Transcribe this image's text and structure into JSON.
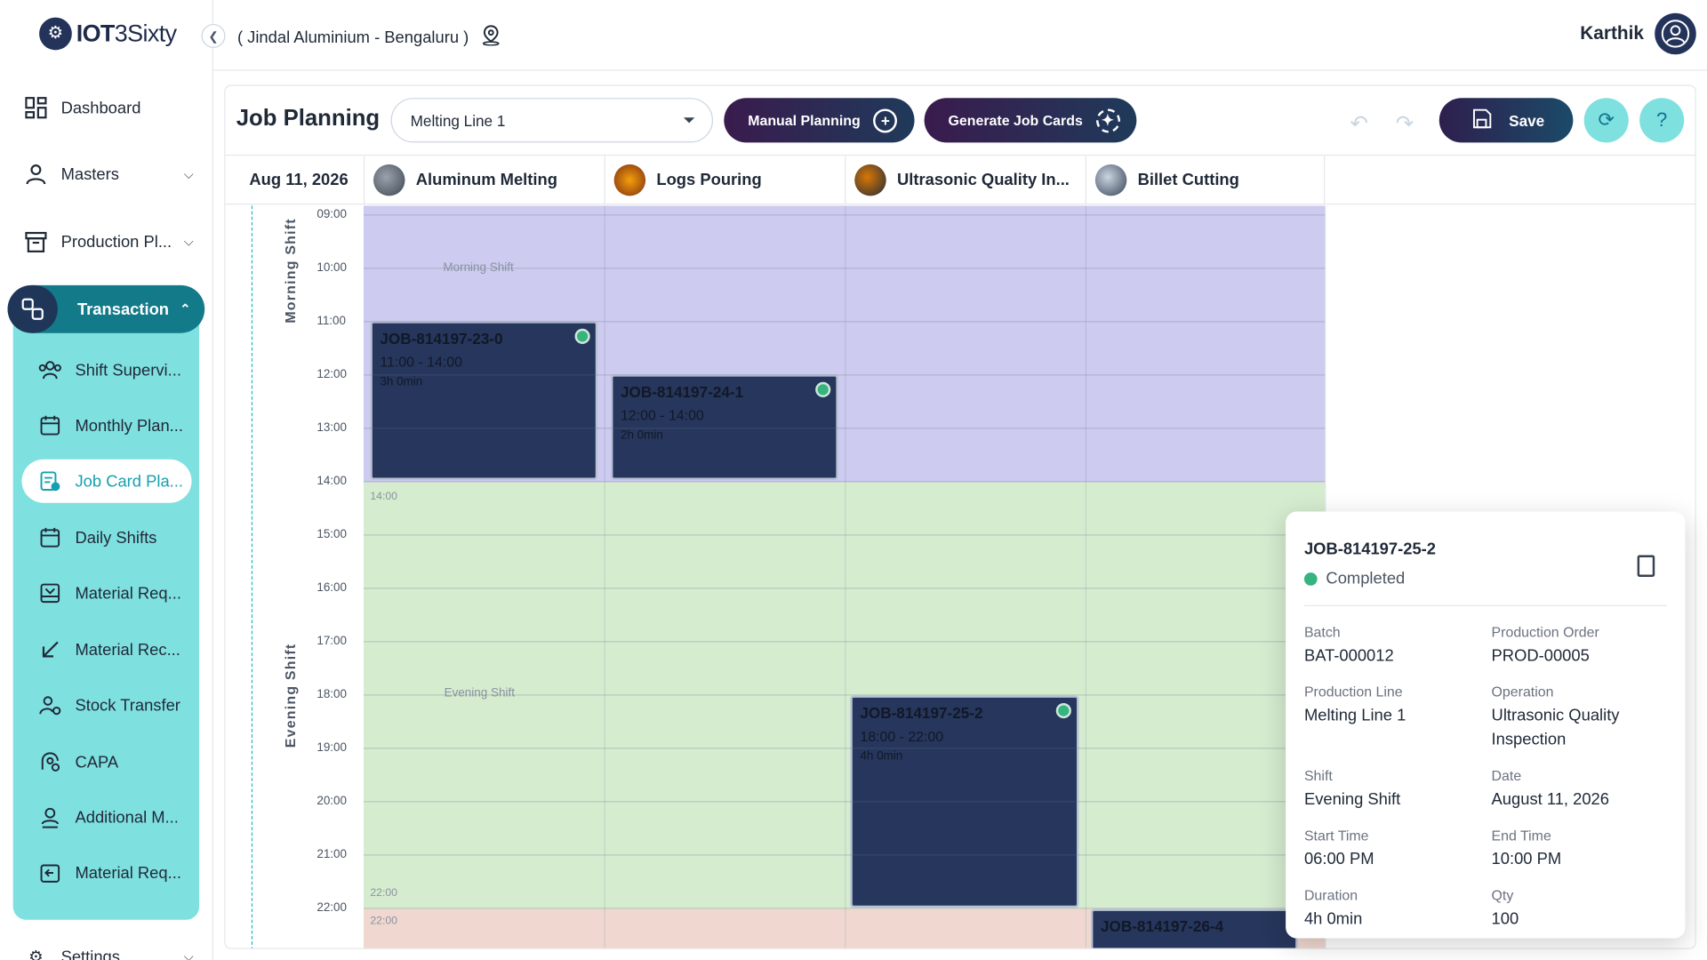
{
  "brand": {
    "logo_text_bold": "IOT",
    "logo_text": "3Sixty"
  },
  "header": {
    "location": "( Jindal Aluminium - Bengaluru )",
    "user_name": "Karthik"
  },
  "sidebar": {
    "items": [
      {
        "label": "Dashboard",
        "icon": "dashboard-icon"
      },
      {
        "label": "Masters",
        "icon": "user-icon"
      },
      {
        "label": "Production Pl...",
        "icon": "archive-icon"
      }
    ],
    "transaction": {
      "label": "Transaction",
      "icon": "transaction-icon"
    },
    "sub_items": [
      {
        "label": "Shift Supervi...",
        "icon": "group-icon"
      },
      {
        "label": "Monthly Plan...",
        "icon": "calendar-icon"
      },
      {
        "label": "Job Card Pla...",
        "icon": "jobcard-icon"
      },
      {
        "label": "Daily Shifts",
        "icon": "calendar-icon"
      },
      {
        "label": "Material Req...",
        "icon": "inbox-icon"
      },
      {
        "label": "Material Rec...",
        "icon": "arrow-down-left-icon"
      },
      {
        "label": "Stock Transfer",
        "icon": "transfer-icon"
      },
      {
        "label": "CAPA",
        "icon": "capa-icon"
      },
      {
        "label": "Additional M...",
        "icon": "person-icon"
      },
      {
        "label": "Material Req...",
        "icon": "return-icon"
      }
    ],
    "settings": {
      "label": "Settings"
    }
  },
  "toolbar": {
    "title": "Job Planning",
    "line_select": "Melting Line 1",
    "manual_planning": "Manual Planning",
    "generate_job_cards": "Generate Job Cards",
    "save": "Save",
    "help": "?"
  },
  "schedule": {
    "date": "Aug 11, 2026",
    "resources": [
      {
        "name": "Aluminum Melting"
      },
      {
        "name": "Logs Pouring"
      },
      {
        "name": "Ultrasonic Quality In..."
      },
      {
        "name": "Billet Cutting"
      }
    ],
    "time_ticks": [
      "09:00",
      "10:00",
      "11:00",
      "12:00",
      "13:00",
      "14:00",
      "15:00",
      "16:00",
      "17:00",
      "18:00",
      "19:00",
      "20:00",
      "21:00",
      "22:00"
    ],
    "shifts": [
      {
        "label": "Morning Shift",
        "band_name": "Morning Shift",
        "start_label": "",
        "end_label": "14:00",
        "color": "#cdcbef"
      },
      {
        "label": "Evening Shift",
        "band_name": "Evening Shift",
        "start_label": "14:00",
        "end_label": "22:00",
        "color": "#d5eccf"
      },
      {
        "label": "",
        "band_name": "",
        "start_label": "22:00",
        "end_label": "",
        "color": "#f0d8d0"
      }
    ],
    "jobs": [
      {
        "id": "JOB-814197-23-0",
        "range": "11:00 - 14:00",
        "duration": "3h 0min"
      },
      {
        "id": "JOB-814197-24-1",
        "range": "12:00 - 14:00",
        "duration": "2h 0min"
      },
      {
        "id": "JOB-814197-25-2",
        "range": "18:00 - 22:00",
        "duration": "4h 0min"
      },
      {
        "id": "JOB-814197-26-4",
        "range": "",
        "duration": ""
      }
    ]
  },
  "popover": {
    "job_id": "JOB-814197-25-2",
    "status": "Completed",
    "status_color": "#36b37e",
    "fields": [
      {
        "label": "Batch",
        "value": "BAT-000012"
      },
      {
        "label": "Production Order",
        "value": "PROD-00005"
      },
      {
        "label": "Production Line",
        "value": "Melting Line 1"
      },
      {
        "label": "Operation",
        "value": "Ultrasonic Quality Inspection"
      },
      {
        "label": "Shift",
        "value": "Evening Shift"
      },
      {
        "label": "Date",
        "value": "August 11, 2026"
      },
      {
        "label": "Start Time",
        "value": "06:00 PM"
      },
      {
        "label": "End Time",
        "value": "10:00 PM"
      },
      {
        "label": "Duration",
        "value": "4h 0min"
      },
      {
        "label": "Qty",
        "value": "100"
      }
    ]
  }
}
